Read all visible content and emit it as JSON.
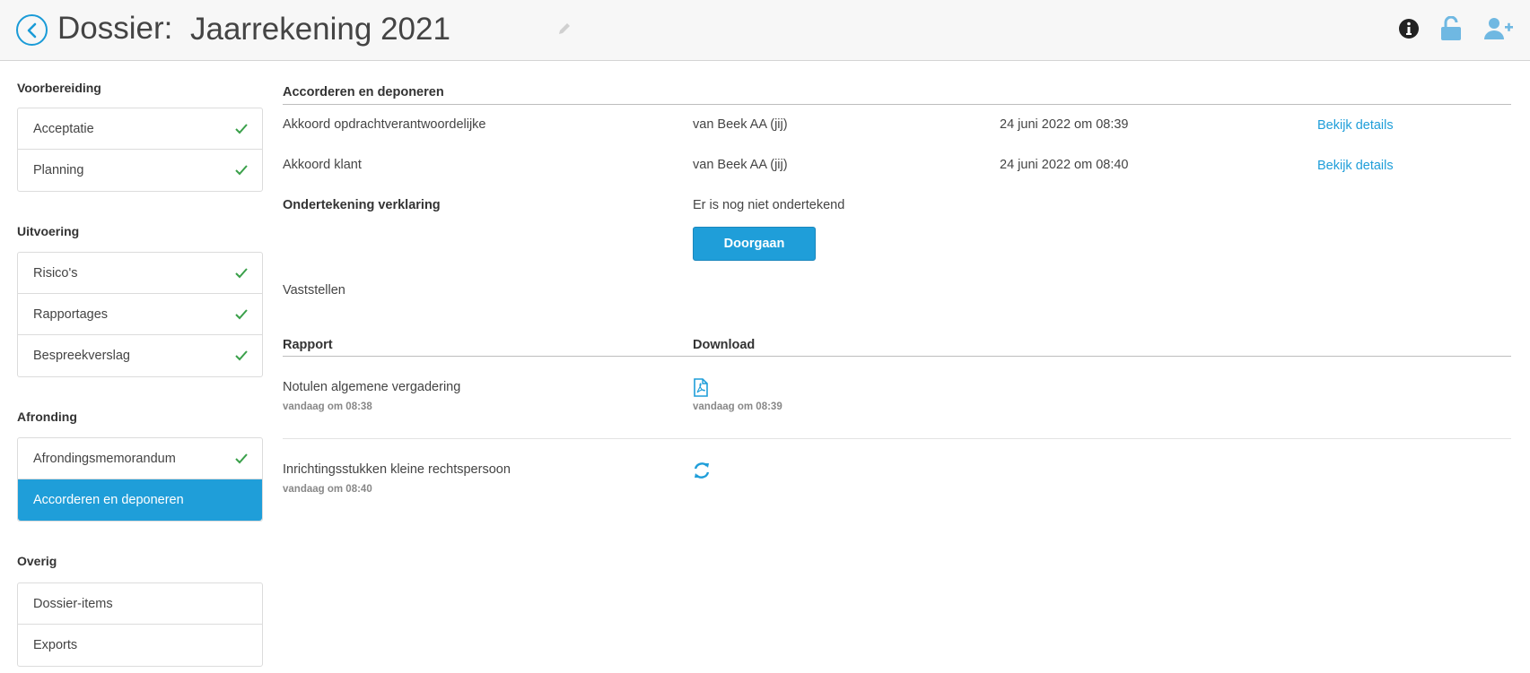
{
  "header": {
    "label": "Dossier:",
    "title": "Jaarrekening 2021",
    "icons": [
      "info-icon",
      "unlock-icon",
      "add-user-icon"
    ],
    "accent": "#1f9ed9"
  },
  "sidebar": {
    "sections": [
      {
        "title": "Voorbereiding",
        "items": [
          {
            "label": "Acceptatie",
            "done": true
          },
          {
            "label": "Planning",
            "done": true
          }
        ]
      },
      {
        "title": "Uitvoering",
        "items": [
          {
            "label": "Risico's",
            "done": true
          },
          {
            "label": "Rapportages",
            "done": true
          },
          {
            "label": "Bespreekverslag",
            "done": true
          }
        ]
      },
      {
        "title": "Afronding",
        "items": [
          {
            "label": "Afrondingsmemorandum",
            "done": true
          },
          {
            "label": "Accorderen en deponeren",
            "done": false,
            "active": true
          }
        ]
      },
      {
        "title": "Overig",
        "items": [
          {
            "label": "Dossier-items",
            "done": false
          },
          {
            "label": "Exports",
            "done": false
          }
        ]
      }
    ]
  },
  "main": {
    "section_title": "Accorderen en deponeren",
    "approvals": [
      {
        "label": "Akkoord opdrachtverantwoordelijke",
        "by": "van Beek AA (jij)",
        "date": "24 juni 2022 om 08:39",
        "link": "Bekijk details"
      },
      {
        "label": "Akkoord klant",
        "by": "van Beek AA (jij)",
        "date": "24 juni 2022 om 08:40",
        "link": "Bekijk details"
      }
    ],
    "signing": {
      "label": "Ondertekening verklaring",
      "status": "Er is nog niet ondertekend",
      "button": "Doorgaan"
    },
    "establish": "Vaststellen",
    "reports_header": {
      "col1": "Rapport",
      "col2": "Download"
    },
    "reports": [
      {
        "name": "Notulen algemene vergadering",
        "created": "vandaag om 08:38",
        "download_icon": "pdf-icon",
        "download_time": "vandaag om 08:39"
      },
      {
        "name": "Inrichtingsstukken kleine rechtspersoon",
        "created": "vandaag om 08:40",
        "download_icon": "refresh-icon",
        "download_time": ""
      }
    ]
  }
}
